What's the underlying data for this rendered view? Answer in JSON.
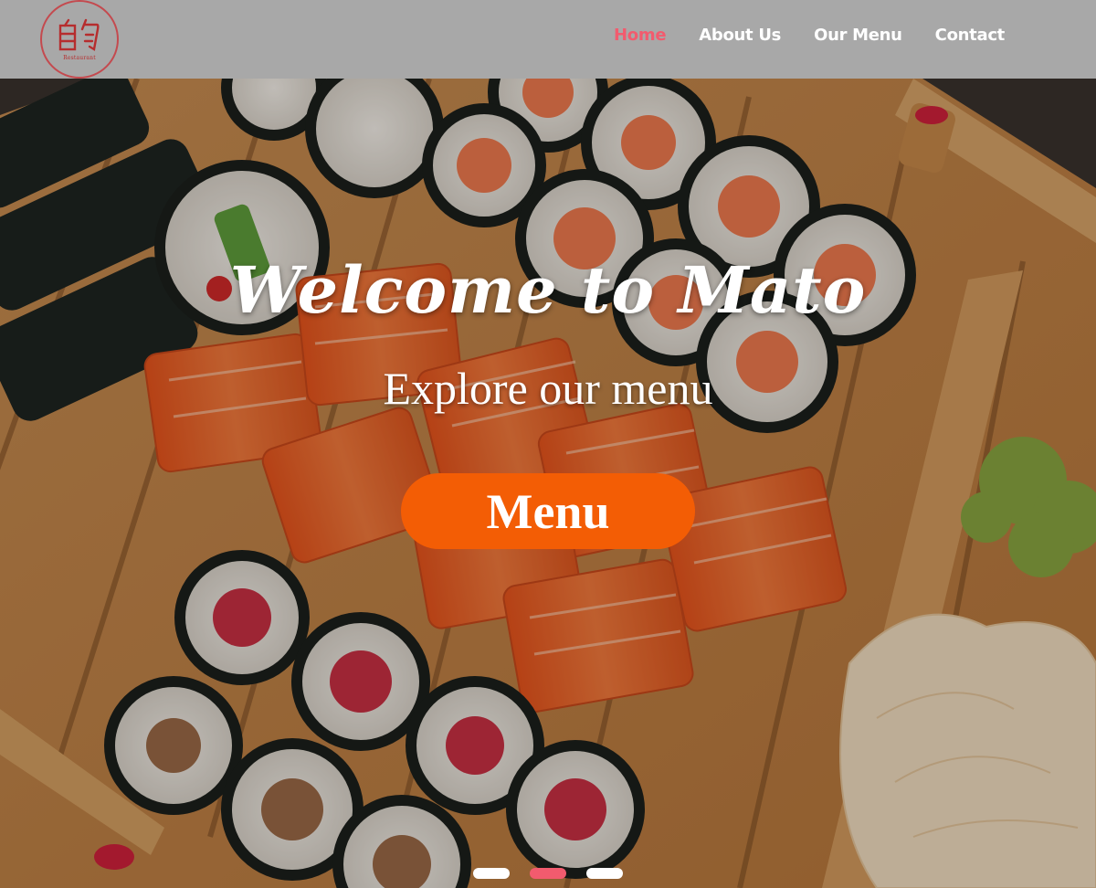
{
  "logo": {
    "glyphs": "自匀",
    "subtitle": "Restaurant"
  },
  "nav": {
    "items": [
      {
        "label": "Home",
        "active": true
      },
      {
        "label": "About Us",
        "active": false
      },
      {
        "label": "Our Menu",
        "active": false
      },
      {
        "label": "Contact",
        "active": false
      }
    ]
  },
  "hero": {
    "title": "Welcome to Mato",
    "subtitle": "Explore our menu",
    "button_label": "Menu",
    "slides": {
      "count": 3,
      "active_index": 1
    }
  },
  "colors": {
    "nav_bg": "#a8a8a8",
    "nav_active": "#f25b6e",
    "button_bg": "#f35d05",
    "text": "#ffffff"
  }
}
